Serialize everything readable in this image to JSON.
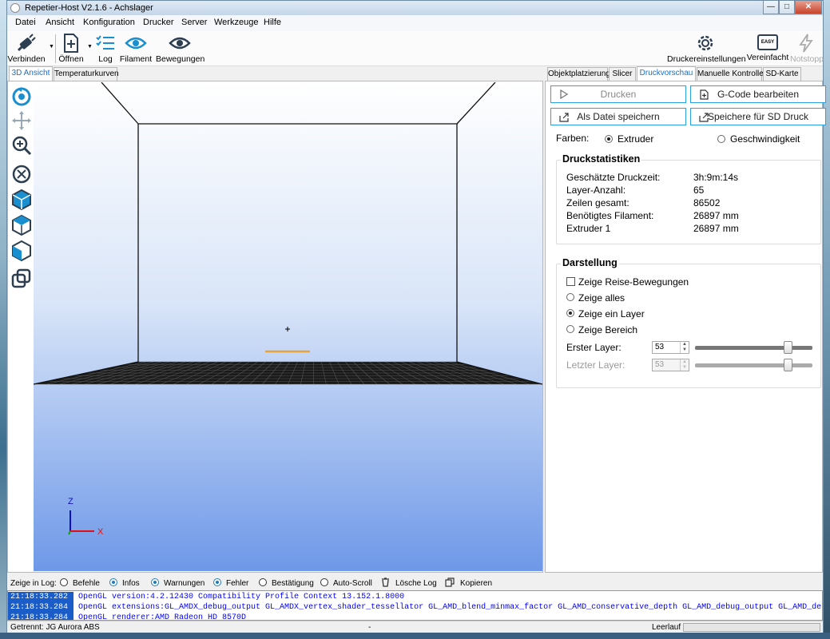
{
  "window": {
    "title": "Repetier-Host V2.1.6 - Achslager"
  },
  "menu": [
    "Datei",
    "Ansicht",
    "Konfiguration",
    "Drucker",
    "Server",
    "Werkzeuge",
    "Hilfe"
  ],
  "toolbar": {
    "connect": "Verbinden",
    "open": "Öffnen",
    "log": "Log",
    "filament": "Filament",
    "moves": "Bewegungen",
    "printer_settings": "Druckereinstellungen",
    "easy": "Vereinfacht",
    "easy_badge": "EASY",
    "emergency": "Notstopp"
  },
  "left_tabs": [
    "3D Ansicht",
    "Temperaturkurven"
  ],
  "right_tabs": [
    "Objektplatzierung",
    "Slicer",
    "Druckvorschau",
    "Manuelle Kontrolle",
    "SD-Karte"
  ],
  "preview": {
    "print_label": "Drucken",
    "edit_gcode_label": "G-Code bearbeiten",
    "save_file_label": "Als Datei speichern",
    "save_sd_label": "Speichere für SD Druck",
    "colors_label": "Farben:",
    "color_extruder": "Extruder",
    "color_speed": "Geschwindigkeit",
    "stats_title": "Druckstatistiken",
    "stats": [
      {
        "label": "Geschätzte Druckzeit:",
        "value": "3h:9m:14s"
      },
      {
        "label": "Layer-Anzahl:",
        "value": "65"
      },
      {
        "label": "Zeilen gesamt:",
        "value": "86502"
      },
      {
        "label": "Benötigtes Filament:",
        "value": "26897 mm"
      },
      {
        "label": "Extruder 1",
        "value": "26897 mm"
      }
    ],
    "display_title": "Darstellung",
    "show_travel": "Zeige Reise-Bewegungen",
    "show_all": "Zeige alles",
    "show_one_layer": "Zeige ein Layer",
    "show_range": "Zeige Bereich",
    "first_layer_label": "Erster Layer:",
    "first_layer_value": "53",
    "last_layer_label": "Letzter Layer:",
    "last_layer_value": "53"
  },
  "axes": {
    "z": "Z",
    "x": "X"
  },
  "log": {
    "show_in_log": "Zeige in Log:",
    "filters": [
      {
        "label": "Befehle",
        "on": false
      },
      {
        "label": "Infos",
        "on": true
      },
      {
        "label": "Warnungen",
        "on": true
      },
      {
        "label": "Fehler",
        "on": true
      },
      {
        "label": "Bestätigung",
        "on": false
      },
      {
        "label": "Auto-Scroll",
        "on": false
      }
    ],
    "clear_label": "Lösche Log",
    "copy_label": "Kopieren",
    "lines": [
      {
        "time": "21:18:33.282",
        "text": "OpenGL version:4.2.12430 Compatibility Profile Context 13.152.1.8000"
      },
      {
        "time": "21:18:33.284",
        "text": "OpenGL extensions:GL_AMDX_debug_output GL_AMDX_vertex_shader_tessellator GL_AMD_blend_minmax_factor GL_AMD_conservative_depth GL_AMD_debug_output GL_AMD_dep"
      },
      {
        "time": "21:18:33.284",
        "text": "OpenGL renderer:AMD Radeon HD 8570D"
      }
    ]
  },
  "status": {
    "connection": "Getrennt: JG Aurora ABS",
    "middle": "-",
    "state": "Leerlauf"
  }
}
